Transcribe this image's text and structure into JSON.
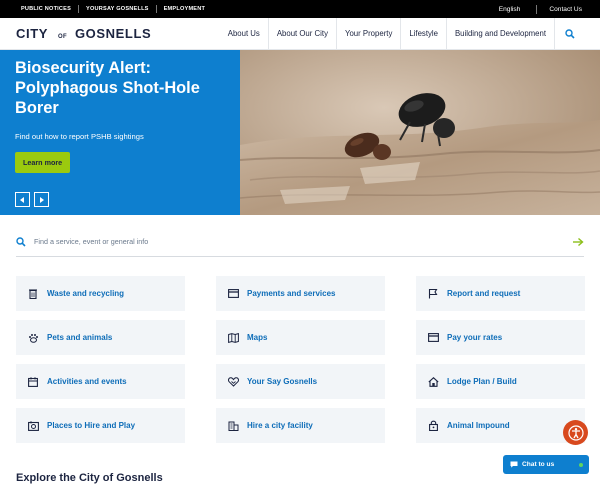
{
  "topbar": {
    "links": [
      "PUBLIC NOTICES",
      "YOURSAY GOSNELLS",
      "EMPLOYMENT"
    ],
    "language": "English",
    "contact": "Contact Us"
  },
  "logo": {
    "city": "CITY",
    "of": "OF",
    "name": "GOSNELLS"
  },
  "nav": {
    "items": [
      "About Us",
      "About Our City",
      "Your Property",
      "Lifestyle",
      "Building and Development"
    ],
    "search_icon": "search-icon"
  },
  "hero": {
    "title": "Biosecurity Alert: Polyphagous Shot-Hole Borer",
    "text": "Find out how to report PSHB sightings",
    "button": "Learn more",
    "bg_color": "#0e7fcf",
    "button_color": "#9bca0e"
  },
  "search": {
    "placeholder": "Find a service, event or general info"
  },
  "tiles": [
    {
      "label": "Waste and recycling",
      "icon": "bin-icon"
    },
    {
      "label": "Payments and services",
      "icon": "card-icon"
    },
    {
      "label": "Report and request",
      "icon": "flag-icon"
    },
    {
      "label": "Pets and animals",
      "icon": "paw-icon"
    },
    {
      "label": "Maps",
      "icon": "map-icon"
    },
    {
      "label": "Pay your rates",
      "icon": "card-icon"
    },
    {
      "label": "Activities and events",
      "icon": "calendar-icon"
    },
    {
      "label": "Your Say Gosnells",
      "icon": "heart-handshake-icon"
    },
    {
      "label": "Lodge Plan / Build",
      "icon": "house-icon"
    },
    {
      "label": "Places to Hire and Play",
      "icon": "booking-icon"
    },
    {
      "label": "Hire a city facility",
      "icon": "building-icon"
    },
    {
      "label": "Animal Impound",
      "icon": "lock-icon"
    }
  ],
  "explore_heading": "Explore the City of Gosnells",
  "chat": {
    "label": "Chat to us"
  },
  "accent": "#0e6db8"
}
